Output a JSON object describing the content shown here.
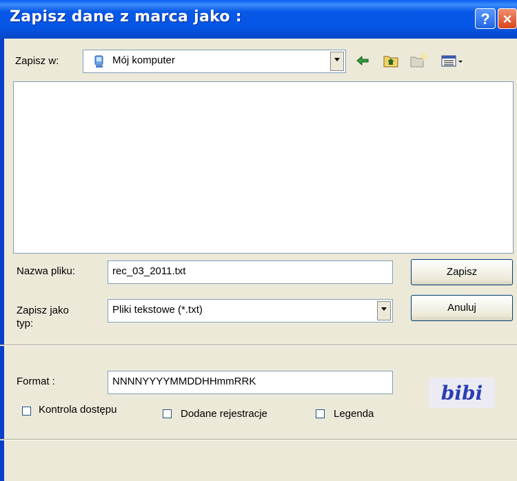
{
  "window": {
    "title": "Zapisz dane z marca jako :"
  },
  "titlebar_buttons": {
    "help": "?",
    "close": "×"
  },
  "location": {
    "label": "Zapisz w:",
    "value": "Mój komputer",
    "icon": "computer-icon"
  },
  "toolbar": {
    "icons": [
      "back-arrow-icon",
      "up-folder-icon",
      "new-folder-icon",
      "view-menu-icon"
    ]
  },
  "filename": {
    "label": "Nazwa pliku:",
    "value": "rec_03_2011.txt"
  },
  "filetype": {
    "label_line1": "Zapisz jako",
    "label_line2": "typ:",
    "value": "Pliki tekstowe (*.txt)"
  },
  "buttons": {
    "save": "Zapisz",
    "cancel": "Anuluj"
  },
  "format": {
    "label": "Format :",
    "value": "NNNNYYYYMMDDHHmmRRK"
  },
  "checkboxes": [
    {
      "label": "Kontrola dostępu",
      "checked": false
    },
    {
      "label": "Dodane rejestracje",
      "checked": false
    },
    {
      "label": "Legenda",
      "checked": false
    }
  ],
  "logo": {
    "text": "bibi"
  }
}
